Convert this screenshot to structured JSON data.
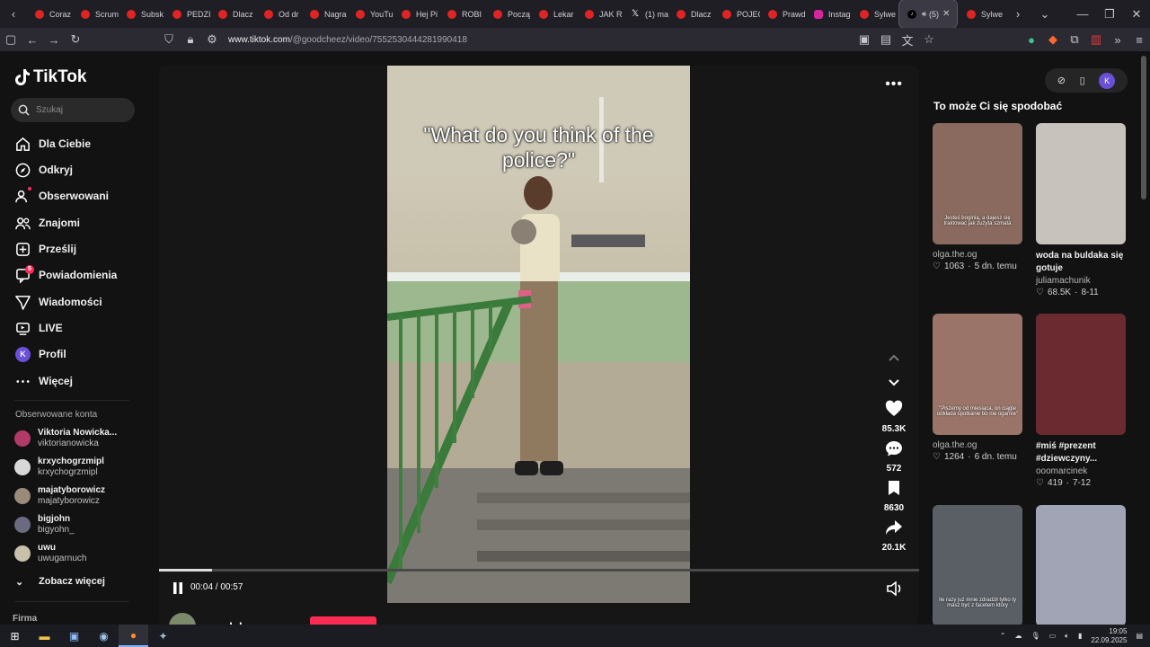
{
  "browser": {
    "tabs": [
      {
        "label": "Coraz",
        "icon": "youtube-icon"
      },
      {
        "label": "Scrum",
        "icon": "youtube-icon"
      },
      {
        "label": "Subsk",
        "icon": "youtube-icon"
      },
      {
        "label": "PEDZI",
        "icon": "youtube-icon"
      },
      {
        "label": "Dlacz",
        "icon": "youtube-icon"
      },
      {
        "label": "Od dr",
        "icon": "youtube-icon"
      },
      {
        "label": "Nagra",
        "icon": "youtube-icon"
      },
      {
        "label": "YouTu",
        "icon": "youtube-icon"
      },
      {
        "label": "Hej Pi",
        "icon": "youtube-icon"
      },
      {
        "label": "ROBI",
        "icon": "youtube-icon"
      },
      {
        "label": "Począ",
        "icon": "youtube-icon"
      },
      {
        "label": "Lekar",
        "icon": "youtube-icon"
      },
      {
        "label": "JAK R",
        "icon": "youtube-icon"
      },
      {
        "label": "(1) ma",
        "icon": "x-icon"
      },
      {
        "label": "Dlacz",
        "icon": "youtube-icon"
      },
      {
        "label": "POJEC",
        "icon": "youtube-icon"
      },
      {
        "label": "Prawd",
        "icon": "youtube-icon"
      },
      {
        "label": "Instag",
        "icon": "instagram-icon"
      }
    ],
    "tab_after_instagram": "Sylwe",
    "active_tab": "(5)",
    "tab_after_active": "Sylwe",
    "url_host": "www.tiktok.com",
    "url_path": "/@goodcheez/video/7552530444281990418"
  },
  "sidebar": {
    "logo": "TikTok",
    "search_placeholder": "Szukaj",
    "nav": [
      {
        "label": "Dla Ciebie",
        "icon": "home-icon"
      },
      {
        "label": "Odkryj",
        "icon": "compass-icon"
      },
      {
        "label": "Obserwowani",
        "icon": "following-icon"
      },
      {
        "label": "Znajomi",
        "icon": "friends-icon"
      },
      {
        "label": "Prześlij",
        "icon": "upload-icon"
      },
      {
        "label": "Powiadomienia",
        "icon": "inbox-icon",
        "badge": "5"
      },
      {
        "label": "Wiadomości",
        "icon": "send-icon"
      },
      {
        "label": "LIVE",
        "icon": "live-icon"
      },
      {
        "label": "Profil",
        "icon": "profile-avatar-icon",
        "avatar_letter": "K"
      },
      {
        "label": "Więcej",
        "icon": "more-icon"
      }
    ],
    "following_heading": "Obserwowane konta",
    "accounts": [
      {
        "name": "Viktoria Nowicka...",
        "handle": "viktorianowicka",
        "color": "#b23a6a"
      },
      {
        "name": "krxychogrzmipl",
        "handle": "krxychogrzmipl",
        "color": "#d8d8d8"
      },
      {
        "name": "majatyborowicz",
        "handle": "majatyborowicz",
        "color": "#9a8a7a"
      },
      {
        "name": "bigjohn",
        "handle": "bigyohn_",
        "color": "#6a6a80"
      },
      {
        "name": "uwu",
        "handle": "uwugarnuch",
        "color": "#c8c0a8"
      }
    ],
    "see_more": "Zobacz więcej",
    "footer_heading": "Firma"
  },
  "video": {
    "caption": "\"What do you think of the police?\"",
    "time_current": "00:04",
    "time_total": "00:57",
    "progress": 0.07,
    "likes": "85.3K",
    "comments": "572",
    "saves": "8630",
    "shares": "20.1K",
    "author": "goodcheez"
  },
  "recommendations": {
    "title": "To może Ci się spodobać",
    "profile_letter": "K",
    "cards": [
      {
        "title": "",
        "user": "olga.the.og",
        "likes": "1063",
        "date": "5 dn. temu",
        "overlay": "Jesteś boginią, a dajesz się traktować jak zużyta szmata",
        "bg": "#8a6a5e"
      },
      {
        "title": "woda na buldaka się gotuje",
        "user": "juliamachunik",
        "likes": "68.5K",
        "date": "8-11",
        "overlay": "",
        "bg": "#c8c2bc"
      },
      {
        "title": "",
        "user": "olga.the.og",
        "likes": "1264",
        "date": "6 dn. temu",
        "overlay": "\"Piszemy od miesiąca, on ciągle odkłada spotkanie bo nie ogarnie\"",
        "bg": "#9a7468"
      },
      {
        "title": "#miś #prezent #dziewczyny...",
        "user": "ooomarcinek",
        "likes": "419",
        "date": "7-12",
        "overlay": "",
        "bg": "#6a2a30"
      },
      {
        "title": "",
        "user": "",
        "likes": "",
        "date": "",
        "overlay": "Ile razy już mnie zdradził tylko ty masz być z facetem który",
        "bg": "#5a5f66"
      },
      {
        "title": "",
        "user": "",
        "likes": "",
        "date": "",
        "overlay": "",
        "bg": "#a0a4b4"
      }
    ]
  },
  "taskbar": {
    "time": "19:05",
    "date": "22.09.2025"
  }
}
